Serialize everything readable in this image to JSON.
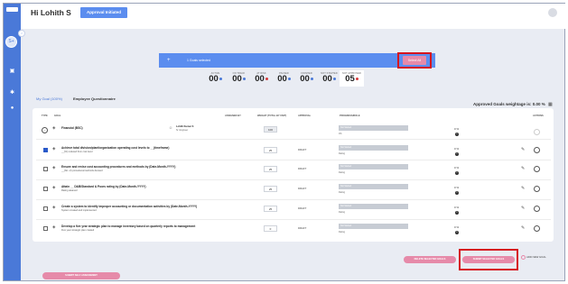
{
  "sidebar": {
    "logo": "Lohith",
    "toggle": "<",
    "bubble": "S+"
  },
  "header": {
    "greeting": "Hi Lohith S",
    "status_badge": "Approval Initiated"
  },
  "selection_bar": {
    "add_icon": "+",
    "count_label": "1 Goals selected",
    "select_all_label": "Select All"
  },
  "counters": [
    {
      "label": "ACTIVE",
      "value": "00",
      "dot": "blue"
    },
    {
      "label": "ON TRACK",
      "value": "00",
      "dot": "blue"
    },
    {
      "label": "AT RISK",
      "value": "00",
      "dot": "red"
    },
    {
      "label": "PAUSED",
      "value": "00",
      "dot": "blue"
    },
    {
      "label": "FINISHED",
      "value": "00",
      "dot": "blue"
    },
    {
      "label": "NOT STARTED",
      "value": "00",
      "dot": "blue"
    },
    {
      "label": "NOT APPROVED",
      "value": "05",
      "dot": "red"
    }
  ],
  "tabs": {
    "my_goal": "My Goal (100%)",
    "questionnaire": "Employee Questionnaire"
  },
  "weightage_label": "Approved Goals weightage is: 0.00 %",
  "table": {
    "headers": {
      "type": "TYPE",
      "goal": "GOAL",
      "assigned_by": "ASSIGNED BY",
      "weight": "WEIGHT (TOTAL BY UNIT)",
      "approval": "APPROVAL",
      "progress": "PROGRESS/ROLE",
      "actions": "ACTIONS"
    },
    "financial_row": {
      "title": "Financial (BSC)",
      "assigner_name": "Lohith Kumar S",
      "assigner_role": "Sr. Engineer",
      "weight": "100",
      "progress_label": "Not Started",
      "percent": "0 %",
      "rating": "0%"
    },
    "goals": [
      {
        "title": "Achieve total division/plant/organization operating cost levels to __(timeframe)",
        "subtitle": "__(%) reduced from cost level",
        "weight": "25",
        "approval": "DRAFT",
        "progress_label": "Not Started",
        "rating": "Rating",
        "percent": "0 %",
        "checked": true
      },
      {
        "title": "Ensure and revise cost accounting procedures and methods by (Date-Month-YYYY)",
        "subtitle": "__(No. of) procedures/methods devised",
        "weight": "25",
        "approval": "DRAFT",
        "progress_label": "Not Started",
        "rating": "Rating",
        "percent": "0 %",
        "checked": false
      },
      {
        "title": "Attain __ D&B/Standard & Poors rating by (Date-Month-YYYY)",
        "subtitle": "Rating attained",
        "weight": "25",
        "approval": "DRAFT",
        "progress_label": "Not Started",
        "rating": "Rating",
        "percent": "0 %",
        "checked": false
      },
      {
        "title": "Create a system to identify improper accounting or documentation activities by (Date-Month-YYYY)",
        "subtitle": "System created and implemented",
        "weight": "25",
        "approval": "DRAFT",
        "progress_label": "Not Started",
        "rating": "Rating",
        "percent": "0 %",
        "checked": false
      },
      {
        "title": "Develop a five year strategic plan to manage inventory based on quarterly reports to management",
        "subtitle": "Five year strategic plan created",
        "weight": "0",
        "approval": "DRAFT",
        "progress_label": "Not Started",
        "rating": "Rating",
        "percent": "0 %",
        "checked": false
      }
    ]
  },
  "footer": {
    "delete_label": "DELETE SELECTED GOALS",
    "submit_label": "SUBMIT SELECTED GOALS",
    "add_new_goal": "ADD NEW GOAL",
    "submit_assessment": "SUBMIT SELF ASSESSMENT"
  },
  "colors": {
    "primary": "#4a79d8",
    "accent_pink": "#e68aa9",
    "highlight_red": "#d6151f"
  }
}
